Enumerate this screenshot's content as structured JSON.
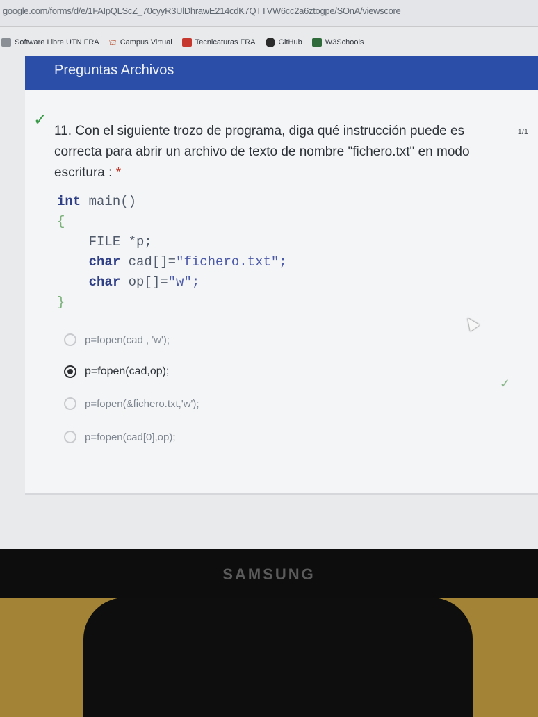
{
  "browser": {
    "url": "google.com/forms/d/e/1FAIpQLScZ_70cyyR3UlDhrawE214cdK7QTTVW6cc2a6ztogpe/SOnA/viewscore",
    "bookmarks": [
      {
        "icon": "folder-icon",
        "label": "Software Libre UTN FRA"
      },
      {
        "icon": "campus-icon",
        "label": "Campus Virtual"
      },
      {
        "icon": "red-square-icon",
        "label": "Tecnicaturas FRA"
      },
      {
        "icon": "github-icon",
        "label": "GitHub"
      },
      {
        "icon": "w3-icon",
        "label": "W3Schools"
      }
    ]
  },
  "form": {
    "header_title": "Preguntas Archivos",
    "question": {
      "text": "11. Con el siguiente trozo de programa, diga qué instrucción puede es correcta para abrir un archivo de texto de nombre \"fichero.txt\" en modo escritura :",
      "required_mark": "*",
      "score": "1/1"
    },
    "code": {
      "line1_kw": "int",
      "line1_rest": " main()",
      "line2": "{",
      "line3": "    FILE *p;",
      "line4_kw": "    char",
      "line4_rest": " cad[]=",
      "line4_str": "\"fichero.txt\";",
      "line5_kw": "    char",
      "line5_rest": " op[]=",
      "line5_str": "\"w\";",
      "line6": "}"
    },
    "options": [
      {
        "label": "p=fopen(cad , 'w');",
        "selected": false
      },
      {
        "label": "p=fopen(cad,op);",
        "selected": true
      },
      {
        "label": "p=fopen(&fichero.txt,'w');",
        "selected": false
      },
      {
        "label": "p=fopen(cad[0],op);",
        "selected": false
      }
    ]
  },
  "monitor": {
    "brand": "SAMSUNG"
  }
}
